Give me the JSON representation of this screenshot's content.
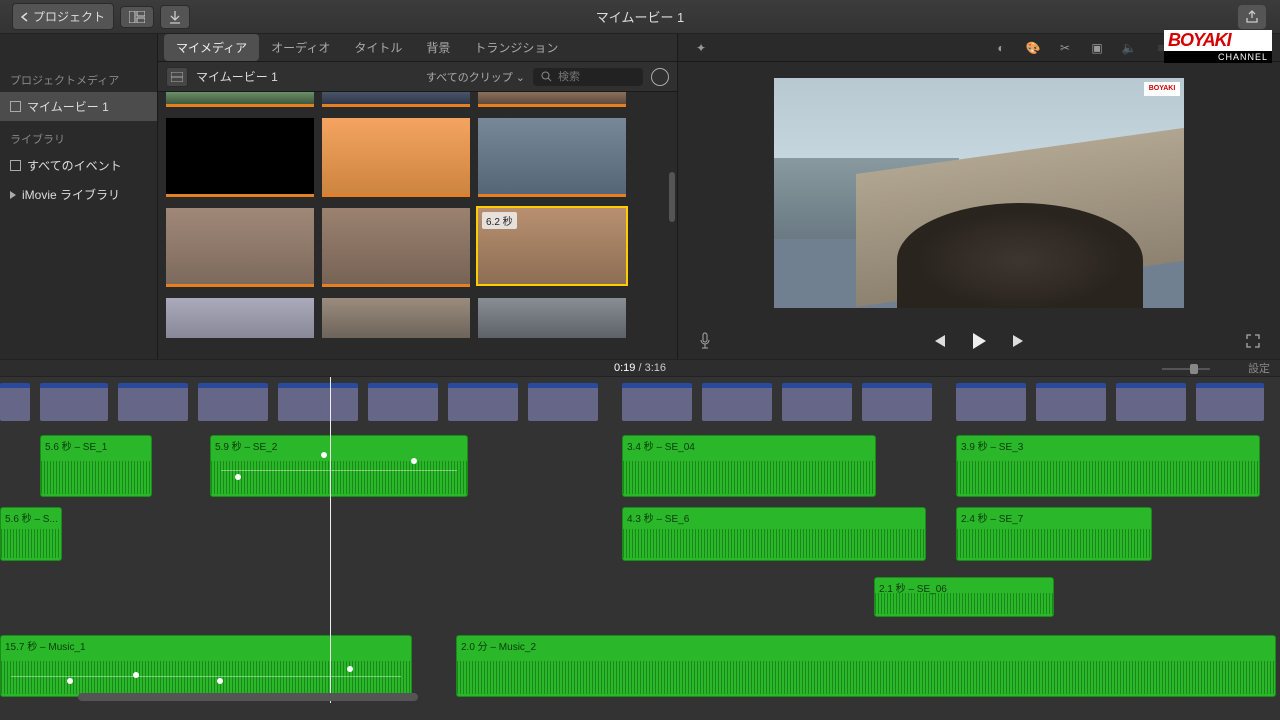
{
  "titlebar": {
    "back_label": "プロジェクト",
    "title": "マイムービー 1"
  },
  "media_tabs": [
    "マイメディア",
    "オーディオ",
    "タイトル",
    "背景",
    "トランジション"
  ],
  "sidebar": {
    "section1": "プロジェクトメディア",
    "project_item": "マイムービー 1",
    "section2": "ライブラリ",
    "all_events": "すべてのイベント",
    "imovie_lib": "iMovie ライブラリ"
  },
  "browser": {
    "project_name": "マイムービー 1",
    "filter": "すべてのクリップ",
    "search_placeholder": "検索",
    "selected_clip_duration": "6.2 秒"
  },
  "viewer": {
    "mini_logo": "BOYAKI"
  },
  "timeline": {
    "time_current": "0:19",
    "time_total": "3:16",
    "settings": "設定",
    "tracks": {
      "se1": "5.6 秒 – SE_1",
      "se2": "5.9 秒 – SE_2",
      "se3": "3.9 秒 – SE_3",
      "se04": "3.4 秒 – SE_04",
      "se5": "5.6 秒 – S...",
      "se6": "4.3 秒 – SE_6",
      "se7": "2.4 秒 – SE_7",
      "se06": "2.1 秒 – SE_06",
      "music1": "15.7 秒 – Music_1",
      "music2": "2.0 分 – Music_2"
    }
  },
  "watermark": {
    "top": "BOYAKI",
    "bottom": "CHANNEL"
  }
}
